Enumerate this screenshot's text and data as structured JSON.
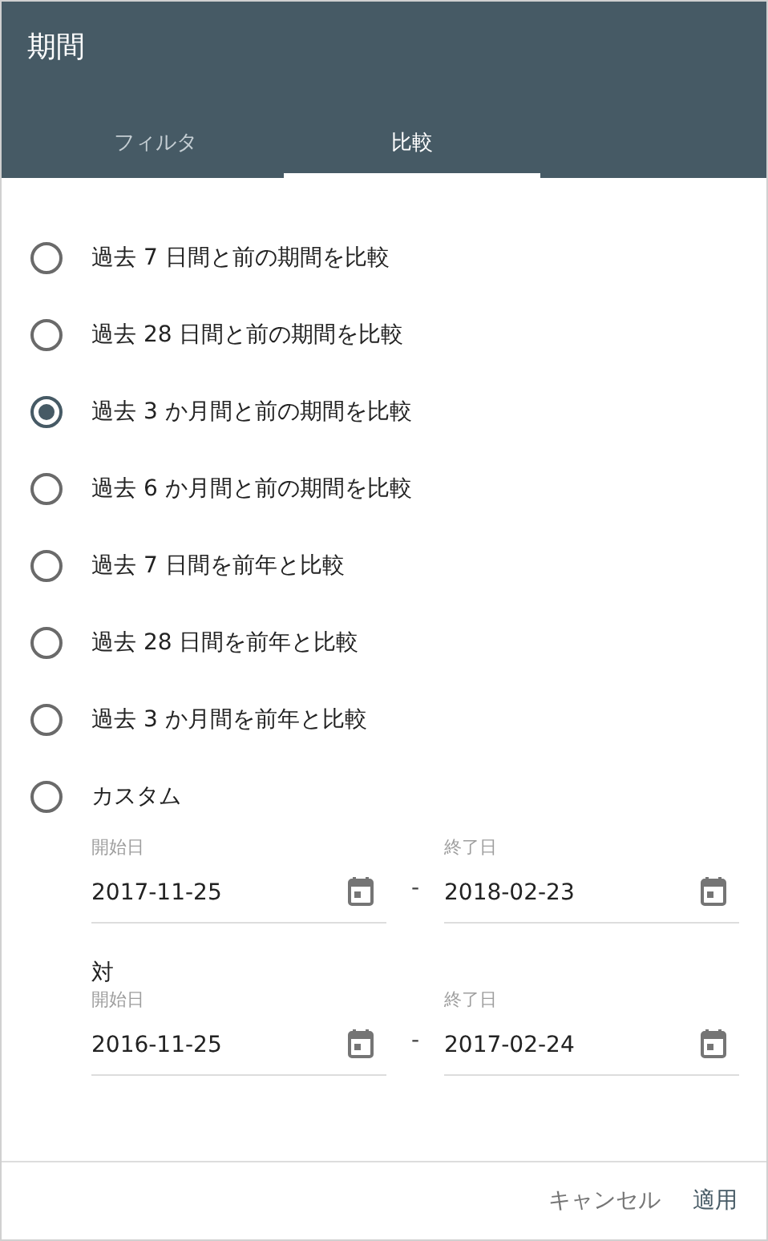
{
  "title": "期間",
  "tabs": [
    {
      "label": "フィルタ",
      "selected": false
    },
    {
      "label": "比較",
      "selected": true
    }
  ],
  "options": [
    {
      "label": "過去 7 日間と前の期間を比較",
      "selected": false
    },
    {
      "label": "過去 28 日間と前の期間を比較",
      "selected": false
    },
    {
      "label": "過去 3 か月間と前の期間を比較",
      "selected": true
    },
    {
      "label": "過去 6 か月間と前の期間を比較",
      "selected": false
    },
    {
      "label": "過去 7 日間を前年と比較",
      "selected": false
    },
    {
      "label": "過去 28 日間を前年と比較",
      "selected": false
    },
    {
      "label": "過去 3 か月間を前年と比較",
      "selected": false
    },
    {
      "label": "カスタム",
      "selected": false
    }
  ],
  "ranges": [
    {
      "start": {
        "label": "開始日",
        "value": "2017-11-25"
      },
      "separator": "-",
      "end": {
        "label": "終了日",
        "value": "2018-02-23"
      }
    },
    {
      "heading": "対",
      "start": {
        "label": "開始日",
        "value": "2016-11-25"
      },
      "separator": "-",
      "end": {
        "label": "終了日",
        "value": "2017-02-24"
      }
    }
  ],
  "buttons": [
    "キャンセル",
    "適用"
  ]
}
